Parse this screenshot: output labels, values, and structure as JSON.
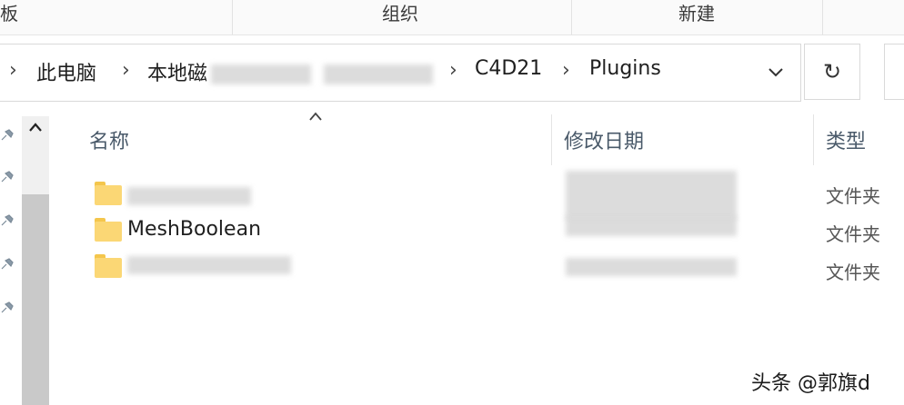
{
  "ribbon": {
    "groups": [
      "粘贴板",
      "组织",
      "新建"
    ]
  },
  "address_bar": {
    "crumbs": [
      "此电脑",
      "本地磁",
      "C4D21",
      "Plugins"
    ],
    "dropdown_icon": "chevron-down-icon",
    "refresh_glyph": "↻"
  },
  "columns": {
    "name": "名称",
    "modified": "修改日期",
    "type": "类型"
  },
  "files": [
    {
      "name": "",
      "type": "文件夹",
      "blurred": true
    },
    {
      "name": "MeshBoolean",
      "type": "文件夹",
      "blurred": false
    },
    {
      "name": "",
      "type": "文件夹",
      "blurred": true
    }
  ],
  "watermark": "头条 @郭旗d"
}
